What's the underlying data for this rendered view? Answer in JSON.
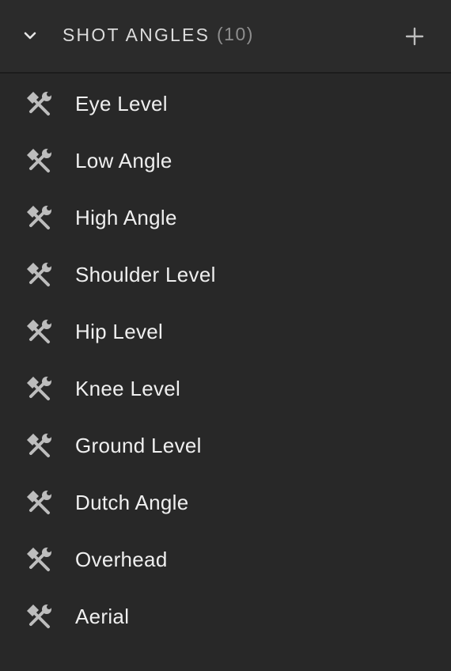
{
  "header": {
    "title": "SHOT ANGLES",
    "count": "(10)",
    "collapse_icon": "chevron-down-icon",
    "add_icon": "plus-icon"
  },
  "colors": {
    "background": "#282828",
    "header_background": "#2b2b2b",
    "text": "#efefef",
    "muted_text": "#8e8e8e",
    "icon": "#bdbdbd"
  },
  "items": [
    {
      "label": "Eye Level",
      "icon": "hammer-wrench-icon"
    },
    {
      "label": "Low Angle",
      "icon": "hammer-wrench-icon"
    },
    {
      "label": "High Angle",
      "icon": "hammer-wrench-icon"
    },
    {
      "label": "Shoulder Level",
      "icon": "hammer-wrench-icon"
    },
    {
      "label": "Hip Level",
      "icon": "hammer-wrench-icon"
    },
    {
      "label": "Knee Level",
      "icon": "hammer-wrench-icon"
    },
    {
      "label": "Ground Level",
      "icon": "hammer-wrench-icon"
    },
    {
      "label": "Dutch Angle",
      "icon": "hammer-wrench-icon"
    },
    {
      "label": "Overhead",
      "icon": "hammer-wrench-icon"
    },
    {
      "label": "Aerial",
      "icon": "hammer-wrench-icon"
    }
  ]
}
